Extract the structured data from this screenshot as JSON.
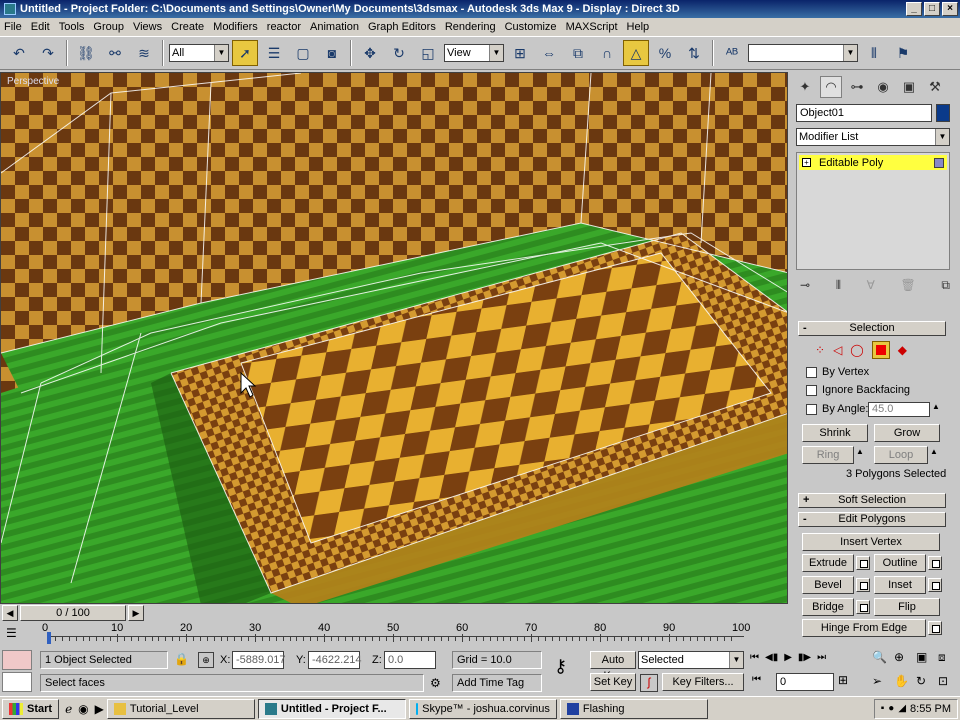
{
  "window": {
    "title": "Untitled    - Project Folder: C:\\Documents and Settings\\Owner\\My Documents\\3dsmax    - Autodesk 3ds Max 9    - Display : Direct 3D",
    "buttons": [
      "_",
      "□",
      "×"
    ]
  },
  "menu": [
    "File",
    "Edit",
    "Tools",
    "Group",
    "Views",
    "Create",
    "Modifiers",
    "reactor",
    "Animation",
    "Graph Editors",
    "Rendering",
    "Customize",
    "MAXScript",
    "Help"
  ],
  "toolbar": {
    "selection_filter": "All",
    "reference_coord": "View"
  },
  "viewport": {
    "label": "Perspective"
  },
  "command_panel": {
    "object_name": "Object01",
    "object_color": "#0a3a8a",
    "modifier_list": "Modifier List",
    "stack_item": "Editable Poly",
    "selection": {
      "title": "Selection",
      "by_vertex": "By Vertex",
      "ignore_backfacing": "Ignore Backfacing",
      "by_angle": "By Angle:",
      "angle_value": "45.0",
      "shrink": "Shrink",
      "grow": "Grow",
      "ring": "Ring",
      "loop": "Loop",
      "status": "3 Polygons Selected"
    },
    "soft_selection": "Soft Selection",
    "edit_polygons": {
      "title": "Edit Polygons",
      "insert_vertex": "Insert Vertex",
      "extrude": "Extrude",
      "outline": "Outline",
      "bevel": "Bevel",
      "inset": "Inset",
      "bridge": "Bridge",
      "flip": "Flip",
      "hinge_from_edge": "Hinge From Edge"
    }
  },
  "timeline": {
    "frame_display": "0 / 100",
    "ticks": [
      "0",
      "10",
      "20",
      "30",
      "40",
      "50",
      "60",
      "70",
      "80",
      "90",
      "100"
    ]
  },
  "status": {
    "selection": "1 Object Selected",
    "prompt": "Select faces",
    "x_label": "X:",
    "x_value": "-5889.017",
    "y_label": "Y:",
    "y_value": "-4622.214",
    "z_label": "Z:",
    "z_value": "0.0",
    "grid": "Grid = 10.0",
    "add_time_tag": "Add Time Tag",
    "auto_key": "Auto Key",
    "set_key": "Set Key",
    "key_mode": "Selected",
    "key_filters": "Key Filters...",
    "frame": "0"
  },
  "taskbar": {
    "start": "Start",
    "tasks": [
      "Tutorial_Level",
      "Untitled    - Project F...",
      "Skype™ - joshua.corvinus",
      "Flashing"
    ],
    "clock": "8:55 PM"
  }
}
